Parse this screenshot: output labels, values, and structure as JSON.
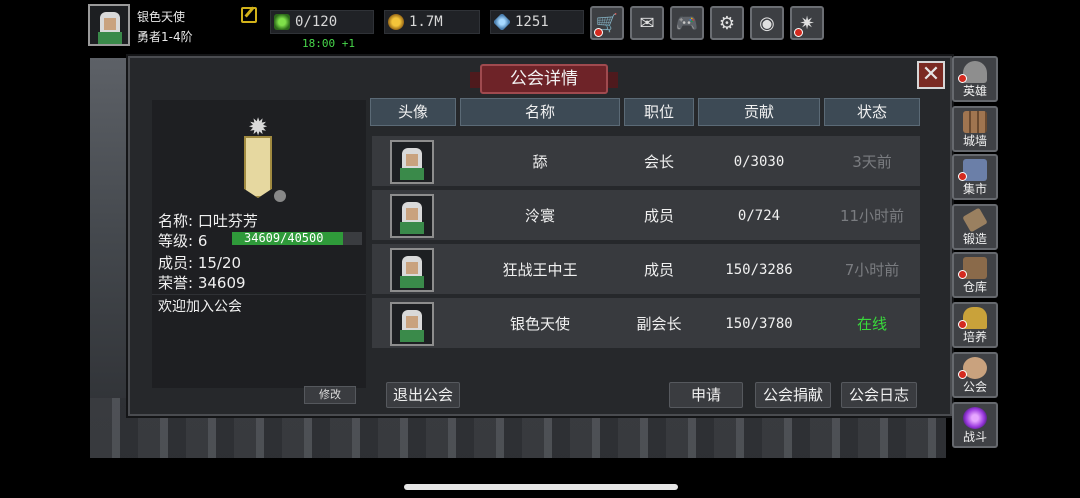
{
  "player": {
    "name": "银色天使",
    "rank": "勇者1-4阶"
  },
  "resources": {
    "energy": "0/120",
    "gold": "1.7M",
    "gems": "1251",
    "timer": "18:00 +1"
  },
  "top_buttons": [
    {
      "name": "shop",
      "icon": "cart-icon",
      "glyph": "🛒"
    },
    {
      "name": "mail",
      "icon": "mail-icon",
      "glyph": "✉"
    },
    {
      "name": "gamepad",
      "icon": "gamepad-icon",
      "glyph": "🎮"
    },
    {
      "name": "settings",
      "icon": "gear-icon",
      "glyph": "⚙"
    },
    {
      "name": "wheel",
      "icon": "color-wheel-icon",
      "glyph": "◉"
    },
    {
      "name": "event",
      "icon": "burst-icon",
      "glyph": "✷"
    }
  ],
  "panel": {
    "title": "公会详情",
    "close": "✕"
  },
  "guild": {
    "name_label": "名称:",
    "name": "口吐芬芳",
    "level_label": "等级:",
    "level": "6",
    "xp_text": "34609/40500",
    "xp_fraction": 0.855,
    "members_label": "成员:",
    "members": "15/20",
    "honor_label": "荣誉:",
    "honor": "34609",
    "notice": "欢迎加入公会",
    "modify": "修改"
  },
  "table": {
    "headers": [
      "头像",
      "名称",
      "职位",
      "贡献",
      "状态"
    ],
    "rows": [
      {
        "name": "舔",
        "role": "会长",
        "contribution": "0/3030",
        "status": "3天前",
        "online": false
      },
      {
        "name": "泠寰",
        "role": "成员",
        "contribution": "0/724",
        "status": "11小时前",
        "online": false
      },
      {
        "name": "狂战王中王",
        "role": "成员",
        "contribution": "150/3286",
        "status": "7小时前",
        "online": false
      },
      {
        "name": "银色天使",
        "role": "副会长",
        "contribution": "150/3780",
        "status": "在线",
        "online": true
      }
    ]
  },
  "buttons": {
    "leave": "退出公会",
    "apply": "申请",
    "donate": "公会捐献",
    "log": "公会日志"
  },
  "side_menu": [
    {
      "label": "英雄",
      "icon": "helmet-icon",
      "color": "#8e8e8e",
      "badge": true
    },
    {
      "label": "城墙",
      "icon": "wall-icon",
      "color": "#a07550",
      "badge": false
    },
    {
      "label": "集市",
      "icon": "market-icon",
      "color": "#6b7fa8",
      "badge": true
    },
    {
      "label": "锻造",
      "icon": "hammer-icon",
      "color": "#9a8060",
      "badge": false
    },
    {
      "label": "仓库",
      "icon": "warehouse-icon",
      "color": "#8a6a4a",
      "badge": true
    },
    {
      "label": "培养",
      "icon": "trophy-icon",
      "color": "#c9a23a",
      "badge": true
    },
    {
      "label": "公会",
      "icon": "guild-icon",
      "color": "#c9a27e",
      "badge": true
    },
    {
      "label": "战斗",
      "icon": "portal-icon",
      "color": "#9b3adf",
      "badge": false
    }
  ]
}
